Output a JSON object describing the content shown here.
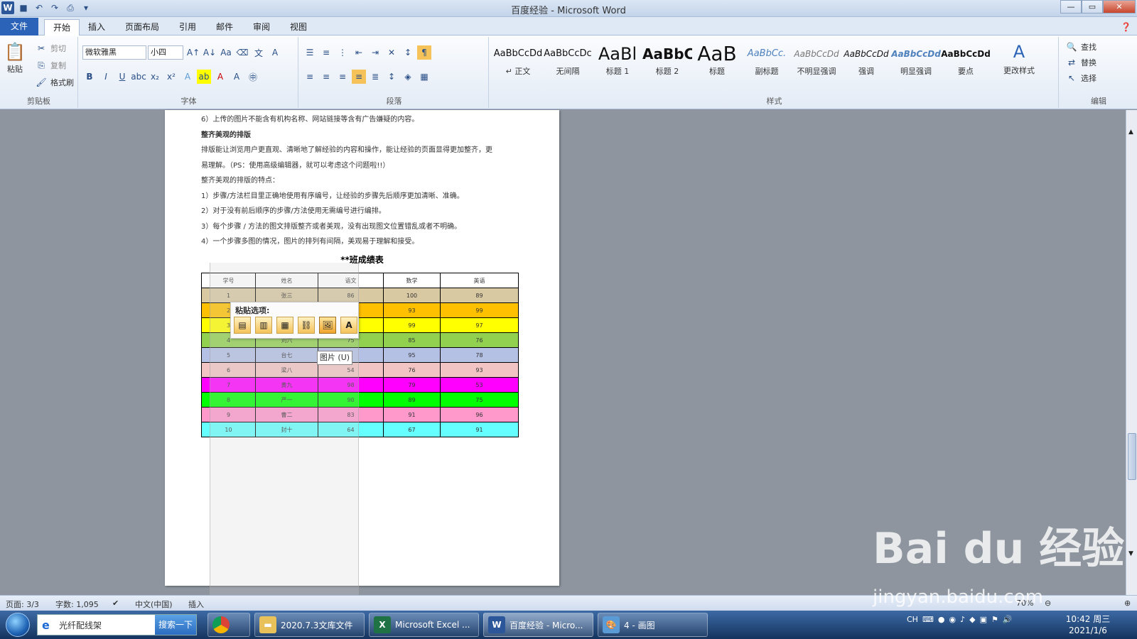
{
  "window": {
    "title": "百度经验 - Microsoft Word"
  },
  "tabs": [
    "文件",
    "开始",
    "插入",
    "页面布局",
    "引用",
    "邮件",
    "审阅",
    "视图"
  ],
  "ribbon": {
    "clipboard": {
      "paste": "粘贴",
      "cut": "剪切",
      "copy": "复制",
      "format_painter": "格式刷",
      "label": "剪贴板"
    },
    "font": {
      "name": "微软雅黑",
      "size": "小四",
      "label": "字体",
      "aa": "Aa"
    },
    "paragraph": {
      "label": "段落"
    },
    "styles": {
      "label": "样式",
      "items": [
        {
          "sample": "AaBbCcDd",
          "name": "↵ 正文"
        },
        {
          "sample": "AaBbCcDc",
          "name": "无间隔"
        },
        {
          "sample": "AaBl",
          "name": "标题 1"
        },
        {
          "sample": "AaBbC",
          "name": "标题 2"
        },
        {
          "sample": "AaB",
          "name": "标题"
        },
        {
          "sample": "AaBbCc.",
          "name": "副标题"
        },
        {
          "sample": "AaBbCcDd",
          "name": "不明显强调"
        },
        {
          "sample": "AaBbCcDd",
          "name": "强调"
        },
        {
          "sample": "AaBbCcDd",
          "name": "明显强调"
        },
        {
          "sample": "AaBbCcDd",
          "name": "要点"
        }
      ],
      "change": "更改样式"
    },
    "editing": {
      "find": "查找",
      "replace": "替换",
      "select": "选择",
      "label": "编辑"
    }
  },
  "document": {
    "lines": [
      {
        "text": "6）上传的图片不能含有机构名称、网站链接等含有广告嫌疑的内容。",
        "bold": false
      },
      {
        "text": "整齐美观的排版",
        "bold": true
      },
      {
        "text": "排版能让浏览用户更直观、清晰地了解经验的内容和操作，能让经验的页面显得更加整齐，更",
        "bold": false
      },
      {
        "text": "易理解。（PS：使用高级编辑器，就可以考虑这个问题啦!!）",
        "bold": false
      },
      {
        "text": "整齐美观的排版的特点：",
        "bold": false
      },
      {
        "text": "1）步骤/方法栏目里正确地使用有序编号，让经验的步骤先后顺序更加清晰、准确。",
        "bold": false
      },
      {
        "text": "2）对于没有前后顺序的步骤/方法使用无需编号进行编排。",
        "bold": false
      },
      {
        "text": "3）每个步骤 / 方法的图文排版整齐或者美观，没有出现图文位置错乱或者不明确。",
        "bold": false
      },
      {
        "text": "4）一个步骤多图的情况，图片的排列有间隔，美观易于理解和接受。",
        "bold": false
      }
    ],
    "table_title": "**班成绩表",
    "table_headers": [
      "学号",
      "姓名",
      "语文",
      "数学",
      "英语"
    ],
    "table_rows": [
      {
        "cells": [
          "1",
          "张三",
          "86",
          "100",
          "89"
        ],
        "color": "#d9c9a3"
      },
      {
        "cells": [
          "2",
          "",
          "",
          "93",
          "99"
        ],
        "color": "#ffc000"
      },
      {
        "cells": [
          "3",
          "",
          "",
          "99",
          "97"
        ],
        "color": "#ffff00"
      },
      {
        "cells": [
          "4",
          "刘六",
          "75",
          "85",
          "76"
        ],
        "color": "#92d050"
      },
      {
        "cells": [
          "5",
          "台七",
          "",
          "95",
          "78"
        ],
        "color": "#b4c0e4"
      },
      {
        "cells": [
          "6",
          "梁八",
          "54",
          "76",
          "93"
        ],
        "color": "#f2c4c4"
      },
      {
        "cells": [
          "7",
          "黄九",
          "98",
          "79",
          "53"
        ],
        "color": "#ff00ff"
      },
      {
        "cells": [
          "8",
          "严一",
          "90",
          "89",
          "75"
        ],
        "color": "#00ff00"
      },
      {
        "cells": [
          "9",
          "曹二",
          "83",
          "91",
          "96"
        ],
        "color": "#ff99cc"
      },
      {
        "cells": [
          "10",
          "封十",
          "64",
          "67",
          "91"
        ],
        "color": "#66ffff"
      }
    ]
  },
  "paste_options": {
    "label": "粘贴选项:",
    "tooltip": "图片 (U)"
  },
  "status": {
    "page": "页面: 3/3",
    "words": "字数: 1,095",
    "lang": "中文(中国)",
    "mode": "插入",
    "zoom": "70%"
  },
  "taskbar": {
    "search_text": "光纤配线架",
    "search_button": "搜索一下",
    "apps": [
      {
        "label": "2020.7.3文库文件"
      },
      {
        "label": "Microsoft Excel ..."
      },
      {
        "label": "百度经验 - Micro..."
      },
      {
        "label": "4 - 画图"
      }
    ],
    "tray_lang": "CH",
    "time": "10:42 周三",
    "date": "2021/1/6"
  },
  "watermark": {
    "main": "Bai du 经验",
    "sub": "jingyan.baidu.com"
  }
}
